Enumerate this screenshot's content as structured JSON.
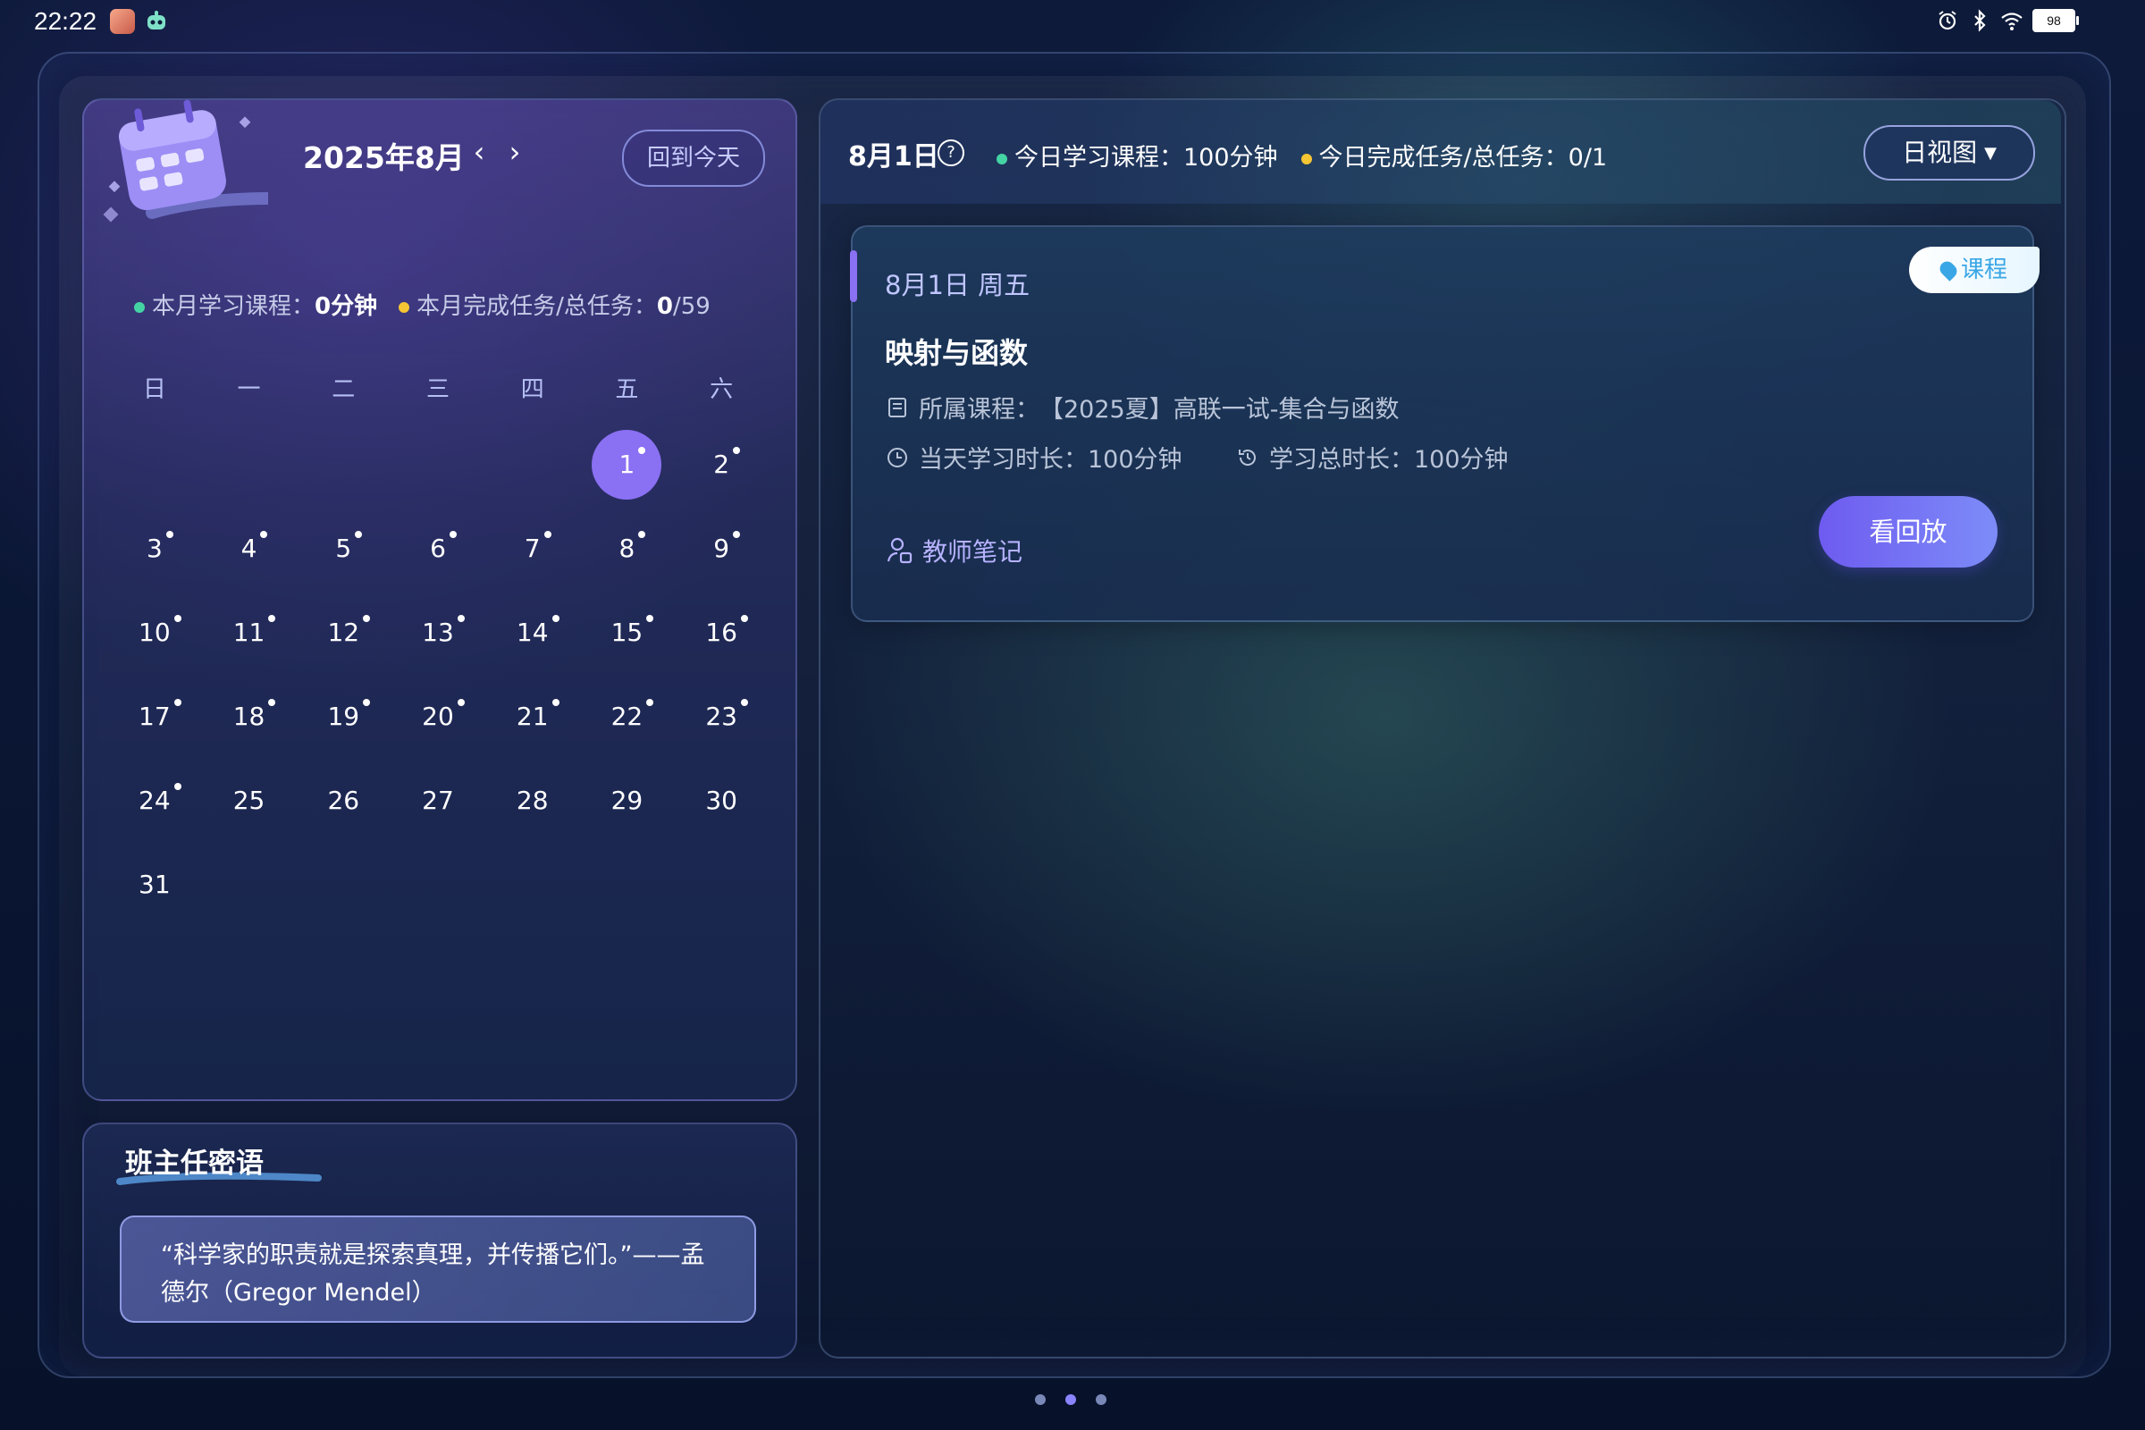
{
  "status_bar": {
    "time": "22:22",
    "battery": "98",
    "icons": [
      "alarm-icon",
      "bluetooth-icon",
      "wifi-icon",
      "battery-icon"
    ]
  },
  "calendar": {
    "title": "2025年8月",
    "today_button": "回到今天",
    "stats": {
      "study_label": "本月学习课程：",
      "study_value": "0分钟",
      "task_label": "本月完成任务/总任务：",
      "task_done": "0",
      "task_total": "/59"
    },
    "weekdays": [
      "日",
      "一",
      "二",
      "三",
      "四",
      "五",
      "六"
    ],
    "selected_day": 1,
    "first_weekday_index": 5,
    "days": [
      {
        "d": "1",
        "dot": true
      },
      {
        "d": "2",
        "dot": true
      },
      {
        "d": "3",
        "dot": true
      },
      {
        "d": "4",
        "dot": true
      },
      {
        "d": "5",
        "dot": true
      },
      {
        "d": "6",
        "dot": true
      },
      {
        "d": "7",
        "dot": true
      },
      {
        "d": "8",
        "dot": true
      },
      {
        "d": "9",
        "dot": true
      },
      {
        "d": "10",
        "dot": true
      },
      {
        "d": "11",
        "dot": true
      },
      {
        "d": "12",
        "dot": true
      },
      {
        "d": "13",
        "dot": true
      },
      {
        "d": "14",
        "dot": true
      },
      {
        "d": "15",
        "dot": true
      },
      {
        "d": "16",
        "dot": true
      },
      {
        "d": "17",
        "dot": true
      },
      {
        "d": "18",
        "dot": true
      },
      {
        "d": "19",
        "dot": true
      },
      {
        "d": "20",
        "dot": true
      },
      {
        "d": "21",
        "dot": true
      },
      {
        "d": "22",
        "dot": true
      },
      {
        "d": "23",
        "dot": true
      },
      {
        "d": "24",
        "dot": true
      },
      {
        "d": "25",
        "dot": false
      },
      {
        "d": "26",
        "dot": false
      },
      {
        "d": "27",
        "dot": false
      },
      {
        "d": "28",
        "dot": false
      },
      {
        "d": "29",
        "dot": false
      },
      {
        "d": "30",
        "dot": false
      },
      {
        "d": "31",
        "dot": false
      }
    ]
  },
  "teacher_message": {
    "title": "班主任密语",
    "quote": "“科学家的职责就是探索真理，并传播它们。”——孟德尔（Gregor Mendel）"
  },
  "day_view": {
    "date": "8月1日",
    "study_label": "今日学习课程：",
    "study_value": "100分钟",
    "task_label": "今日完成任务/总任务：",
    "task_value": "0/1",
    "view_select": "日视图",
    "card": {
      "date": "8月1日 周五",
      "tag": "课程",
      "title": "映射与函数",
      "course_label": "所属课程：",
      "course_value": "【2025夏】高联一试-集合与函数",
      "day_duration": "当天学习时长：100分钟",
      "total_duration": "学习总时长：100分钟",
      "teacher_notes": "教师笔记",
      "replay_button": "看回放"
    }
  },
  "pager": {
    "count": 3,
    "active": 1
  },
  "colors": {
    "accent_purple": "#8a70f3",
    "dot_green": "#44d4a4",
    "dot_yellow": "#f6c533",
    "tag_blue": "#3aa6e6"
  }
}
